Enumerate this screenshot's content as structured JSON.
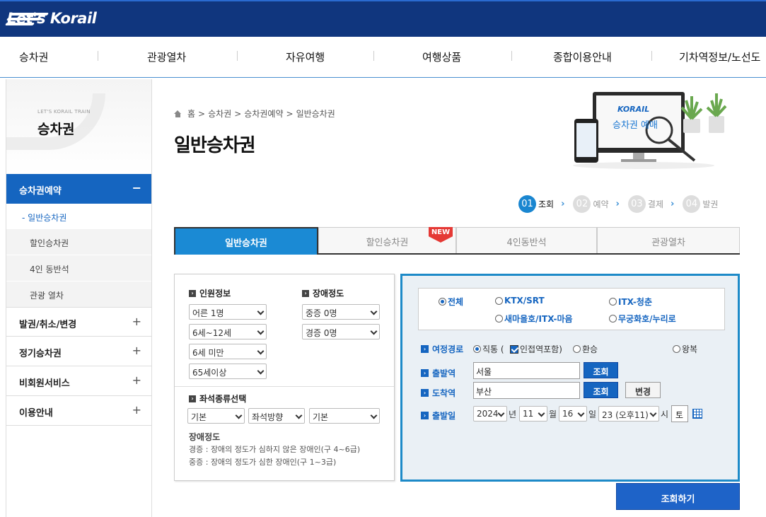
{
  "brand": {
    "logo_text": "Let's Korail"
  },
  "gnb": [
    "승차권",
    "관광열차",
    "자유여행",
    "여행상품",
    "종합이용안내",
    "기차역정보/노선도"
  ],
  "lnb": {
    "small_title": "LET'S KORAIL TRAIN",
    "title": "승차권",
    "active_menu": "승차권예약",
    "active_toggle": "−",
    "sub_items": [
      "일반승차권",
      "할인승차권",
      "4인 동반석",
      "관광 열차"
    ],
    "menus": [
      "발권/취소/변경",
      "정기승차권",
      "비회원서비스",
      "이용안내"
    ],
    "plus": "+"
  },
  "breadcrumb": [
    "홈",
    "승차권",
    "승차권예약",
    "일반승차권"
  ],
  "page_title": "일반승차권",
  "hero": {
    "brand": "KORAIL",
    "caption": "승차권 예매"
  },
  "steps": [
    {
      "num": "01",
      "label": "조회"
    },
    {
      "num": "02",
      "label": "예약"
    },
    {
      "num": "03",
      "label": "결제"
    },
    {
      "num": "04",
      "label": "발권"
    }
  ],
  "tabs": [
    "일반승차권",
    "할인승차권",
    "4인동반석",
    "관광열차"
  ],
  "new_badge": "NEW",
  "passenger": {
    "heading": "인원정보",
    "adult": "어른 1명",
    "child": "6세~12세",
    "infant": "6세 미만",
    "senior": "65세이상"
  },
  "disability": {
    "heading": "장애정도",
    "severe": "중증 0명",
    "mild": "경증 0명"
  },
  "seat": {
    "heading": "좌석종류선택",
    "type": "기본",
    "direction": "좌석방향",
    "option": "기본"
  },
  "disability_note": {
    "title": "장애정도",
    "mild": "경증 : 장애의 정도가 심하지 않은 장애인(구 4~6급)",
    "severe": "중증 : 장애의 정도가 심한 장애인(구 1~3급)"
  },
  "train_types": [
    "전체",
    "KTX/SRT",
    "ITX-청춘",
    "새마을호/ITX-마음",
    "무궁화호/누리로"
  ],
  "route": {
    "label": "여정경로",
    "direct": "직통 (",
    "nearby": "인접역포함)",
    "transfer": "환승",
    "round": "왕복"
  },
  "departure": {
    "label": "출발역",
    "value": "서울",
    "btn": "조회"
  },
  "arrival": {
    "label": "도착역",
    "value": "부산",
    "btn": "조회",
    "swap": "변경"
  },
  "date": {
    "label": "출발일",
    "year": "2024",
    "year_unit": "년",
    "month": "11",
    "month_unit": "월",
    "day": "16",
    "day_unit": "일",
    "hour": "23 (오후11)",
    "hour_unit": "시",
    "weekday": "토"
  },
  "search_button": "조회하기"
}
